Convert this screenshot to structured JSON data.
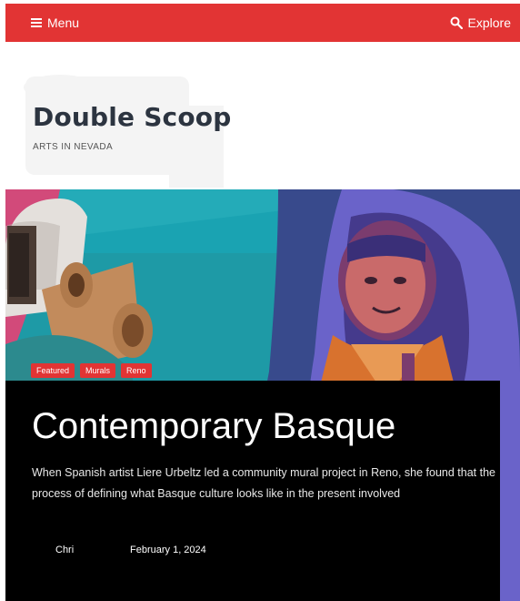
{
  "topbar": {
    "menu_label": "Menu",
    "explore_label": "Explore",
    "menu_icon": "hamburger-icon",
    "explore_icon": "search-icon",
    "background": "#e23434"
  },
  "site": {
    "title": "Double Scoop",
    "tagline": "ARTS IN NEVADA"
  },
  "featured_post": {
    "tags": [
      "Featured",
      "Murals",
      "Reno"
    ],
    "title": "Contemporary Basque",
    "excerpt": "When Spanish artist Liere Urbeltz led a community mural project in Reno, she found that the process of defining what Basque culture looks like in the present involved",
    "author": "Chri",
    "date": "February 1, 2024"
  },
  "colors": {
    "accent": "#e23434",
    "card_background": "#000000",
    "hero_background": "#1e9aa6"
  }
}
